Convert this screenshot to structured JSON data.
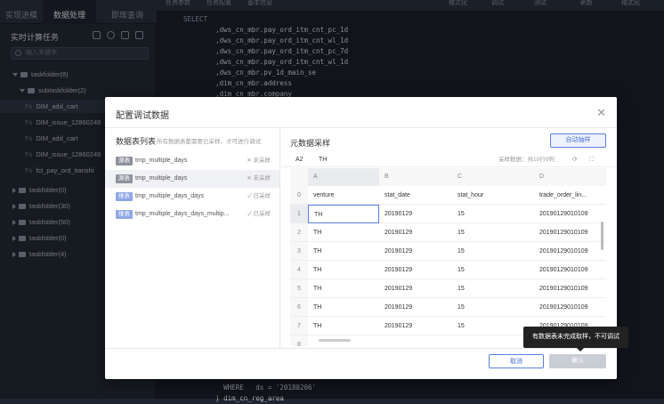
{
  "topbar": {
    "tabs": [
      "实现进模",
      "数据处理",
      "即席查询"
    ],
    "editor_tools": [
      "任务参数",
      "任务配置",
      "基本信息"
    ],
    "right_tools": [
      "格式化",
      "调试",
      "测试",
      "刷新",
      "格式化"
    ]
  },
  "sidebar": {
    "title": "实时计算任务",
    "search_placeholder": "输入关键字",
    "items": [
      {
        "label": "taskfolder(8)",
        "type": "folder",
        "open": true
      },
      {
        "label": "subtaskfolder(2)",
        "type": "folder",
        "open": true
      },
      {
        "label": "DIM_add_cart",
        "type": "file",
        "prefix": "Fs"
      },
      {
        "label": "DIM_issue_12860249",
        "type": "file",
        "prefix": "Fs"
      },
      {
        "label": "DIM_add_cart",
        "type": "file",
        "prefix": "Fs"
      },
      {
        "label": "DIM_issue_12860249",
        "type": "file",
        "prefix": "Fs"
      },
      {
        "label": "fct_pay_ord_tianshi",
        "type": "file",
        "prefix": "Fs"
      },
      {
        "label": "taskfolder(0)",
        "type": "folder",
        "open": false
      },
      {
        "label": "taskfolder(30)",
        "type": "folder",
        "open": false
      },
      {
        "label": "taskfolder(50)",
        "type": "folder",
        "open": false
      },
      {
        "label": "taskfolder(0)",
        "type": "folder",
        "open": false
      },
      {
        "label": "taskfolder(4)",
        "type": "folder",
        "open": false
      }
    ]
  },
  "editor": {
    "lines": [
      {
        "n": "",
        "t": "SELECT"
      },
      {
        "n": "",
        "t": "        ,dws_cn_mbr.pay_ord_itm_cnt_pc_1d"
      },
      {
        "n": "",
        "t": "        ,dws_cn_mbr.pay_ord_itm_cnt_wl_1d"
      },
      {
        "n": "",
        "t": "        ,dws_cn_mbr.pay_ord_itm_cnt_pc_7d"
      },
      {
        "n": "",
        "t": "        ,dws_cn_mbr.pay_ord_itm_cnt_wl_1d"
      },
      {
        "n": "",
        "t": "        ,dws_cn_mbr.pv_1d_main_se"
      },
      {
        "n": "",
        "t": "        ,dim_cn_mbr.address"
      },
      {
        "n": "",
        "t": "        ,dim_cn_mbr.company"
      }
    ],
    "bottom_lines": [
      {
        "n": "",
        "t": "          WHERE   ds = '20180206'"
      },
      {
        "n": "",
        "t": "        ) dim_cn_reg_area"
      }
    ]
  },
  "modal": {
    "title": "配置调试数据",
    "left_title": "数据表列表",
    "left_subtitle": "所有数据表都需要已采样，才可进行调试",
    "tables": [
      {
        "badge": "源表",
        "kind": "src",
        "name": "tmp_multiple_days",
        "status": "未采样",
        "ok": false
      },
      {
        "badge": "源表",
        "kind": "src",
        "name": "tmp_multiple_days",
        "status": "未采样",
        "ok": false
      },
      {
        "badge": "维表",
        "kind": "res",
        "name": "tmp_multiple_days_days",
        "status": "已采样",
        "ok": true
      },
      {
        "badge": "维表",
        "kind": "res",
        "name": "tmp_multiple_days_days_multip...",
        "status": "已采样",
        "ok": true
      }
    ],
    "right_title": "元数据采样",
    "auto_sample": "自动抽样",
    "cell_ref": "A2",
    "cell_value": "TH",
    "sample_info": "采样数据：共10行9列",
    "columns": [
      "A",
      "B",
      "C",
      "D"
    ],
    "header_row": [
      "venture",
      "stat_date",
      "stat_hour",
      "trade_order_lin..."
    ],
    "rows": [
      [
        "TH",
        "20190129",
        "15",
        "20190129010109"
      ],
      [
        "TH",
        "20190129",
        "15",
        "20190129010109"
      ],
      [
        "TH",
        "20190129",
        "15",
        "20190129010109"
      ],
      [
        "TH",
        "20190129",
        "15",
        "20190129010109"
      ],
      [
        "TH",
        "20190129",
        "15",
        "20190129010109"
      ],
      [
        "TH",
        "20190129",
        "15",
        "20190129010109"
      ],
      [
        "TH",
        "20190129",
        "15",
        "20190129010109"
      ]
    ],
    "cancel": "取消",
    "confirm": "确认",
    "tooltip": "有数据表未完成取样，不可调试"
  }
}
